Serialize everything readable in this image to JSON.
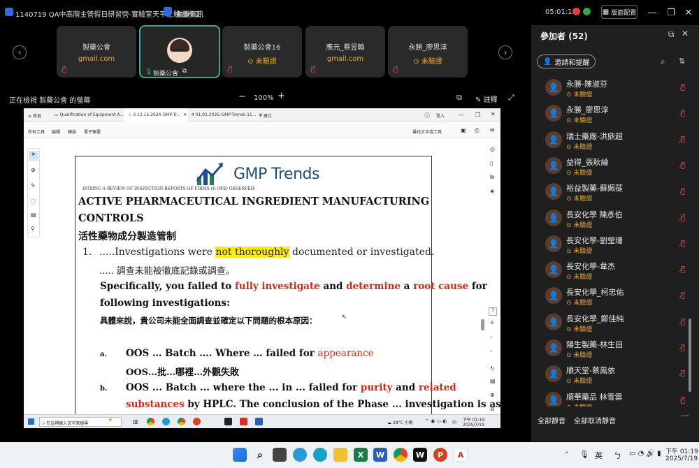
{
  "window": {
    "title": "1140719 QA中高階主管假日研習營-實驗室天平之驗證校正",
    "meeting_info": "會議資訊",
    "timer": "05:01:15",
    "layout_btn": "版面配置"
  },
  "tiles": [
    {
      "name": "製藥公會",
      "sub": "gmail.com",
      "sub_color": "#e8a93a"
    },
    {
      "name": "製藥公會",
      "sub": "",
      "sub_color": "#e8a93a",
      "active": true
    },
    {
      "name": "製藥公會16",
      "sub": "未驗證",
      "sub_color": "#e8a93a"
    },
    {
      "name": "應元_蔡昱翰",
      "sub": "gmail.com",
      "sub_color": "#e8a93a"
    },
    {
      "name": "永勝_廖思淳",
      "sub": "未驗證",
      "sub_color": "#e8a93a"
    }
  ],
  "viewbar": {
    "viewing": "正在檢視 製藥公會 的螢幕",
    "zoom": "100%",
    "annotate": "註釋"
  },
  "panel": {
    "title": "參加者 (52)",
    "invite": "邀請和提醒",
    "mute_all": "全部靜音",
    "unmute_all": "全部取消靜音",
    "participants": [
      {
        "name": "永勝-陳淑芬",
        "status": "未驗證"
      },
      {
        "name": "永勝_廖思淳",
        "status": "未驗證"
      },
      {
        "name": "瑞士藥廠-洪鼎超",
        "status": "未驗證"
      },
      {
        "name": "益得_張耿綸",
        "status": "未驗證"
      },
      {
        "name": "裕益製藥-蘇姵蓰",
        "status": "未驗證"
      },
      {
        "name": "長安化學 陳彥伯",
        "status": "未驗證"
      },
      {
        "name": "長安化學-劉瑩珊",
        "status": "未驗證"
      },
      {
        "name": "長安化學-韋杰",
        "status": "未驗證"
      },
      {
        "name": "長安化學_柯忠佑",
        "status": "未驗證"
      },
      {
        "name": "長安化學_鄭佳純",
        "status": "未驗證"
      },
      {
        "name": "陽生製藥-林生田",
        "status": "未驗證"
      },
      {
        "name": "順天堂-蔡鳳依",
        "status": "未驗證"
      },
      {
        "name": "順華藥品 林雪雲",
        "status": "未驗證"
      }
    ]
  },
  "browser": {
    "tabs": [
      "首頁",
      "Qualification of Equipment A...",
      "3 12.15.2024-GMP-Tr...",
      "4 01.01.2025-GMP-Trends-11...",
      "+ 建立"
    ],
    "login": "登入",
    "toolbar": [
      "所有工具",
      "編輯",
      "轉換",
      "電子簽署"
    ],
    "find_tool": "尋找文字或工具",
    "pages": [
      "7",
      "9"
    ]
  },
  "doc": {
    "logo": "GMP Trends",
    "intro": "DURING A REVIEW OF INSPECTION REPORTS OF FIRMS (I) (WE) OBSERVED:",
    "heading1": "ACTIVE PHARMACEUTICAL INGREDIENT MANUFACTURING",
    "heading2": "CONTROLS",
    "heading_zh": "活性藥物成分製造管制",
    "item_num": "1.",
    "item_pre": ".....Investigations were ",
    "item_hl": "not thoroughly",
    "item_post": " documented or investigated.",
    "item_zh": "..... 調查未能被徹底記錄或調查。",
    "spec1": "Specifically, you failed to ",
    "spec_r1": "fully investigate",
    "spec2": " and ",
    "spec_r2": "determine",
    "spec3": " a ",
    "spec_r3": "root cause",
    "spec4": " for",
    "spec5": "following investigations:",
    "spec_zh": "具體來說，貴公司未能全面調查並確定以下問題的根本原因：",
    "a_label": "a.",
    "a_text": "OOS … Batch …. Where … failed for ",
    "a_red": "appearance",
    "a_zh": "OOS…批…哪裡…外觀失敗",
    "b_label": "b.",
    "b_text1": "OOS ... Batch ... where the ... in ... failed for ",
    "b_red1": "purity",
    "b_and": " and ",
    "b_red2": "related",
    "b_red3": "substances",
    "b_text2": " by HPLC. The conclusion of the Phase ... investigation is as"
  },
  "win_taskbar": {
    "search": "在這裡輸入文字來搜尋",
    "weather": "28°C 小雨",
    "lang": "中",
    "time": "下午 01:19",
    "date": "2025/7/19"
  },
  "taskbar": {
    "lang": "英",
    "time": "下午 01:19",
    "date": "2025/7/19"
  }
}
